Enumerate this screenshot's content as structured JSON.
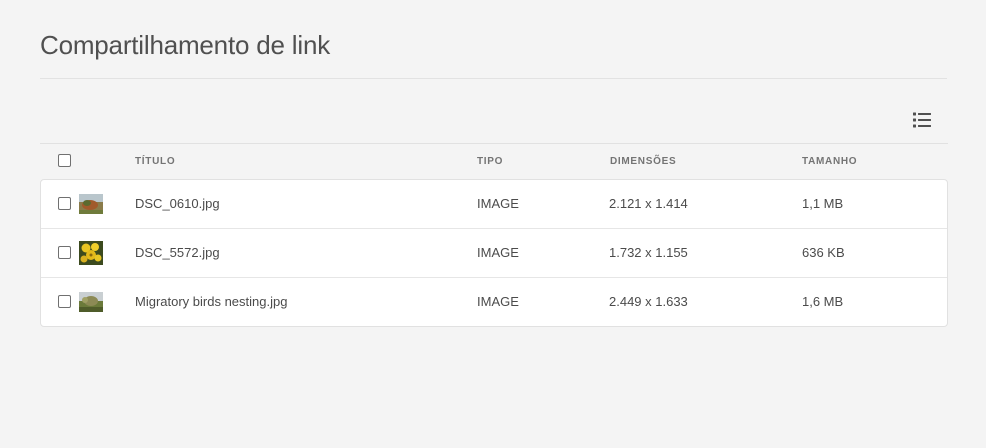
{
  "page": {
    "title": "Compartilhamento de link"
  },
  "toolbar": {
    "view_icon": "list-view-icon"
  },
  "table": {
    "columns": {
      "title": "TÍTULO",
      "type": "TIPO",
      "dimensions": "DIMENSÕES",
      "size": "TAMANHO"
    },
    "rows": [
      {
        "title": "DSC_0610.jpg",
        "type": "IMAGE",
        "dimensions": "2.121 x 1.414",
        "size": "1,1 MB",
        "thumb": "landscape-thumbnail"
      },
      {
        "title": "DSC_5572.jpg",
        "type": "IMAGE",
        "dimensions": "1.732 x 1.155",
        "size": "636 KB",
        "thumb": "yellow-flowers-thumbnail"
      },
      {
        "title": "Migratory birds nesting.jpg",
        "type": "IMAGE",
        "dimensions": "2.449 x 1.633",
        "size": "1,6 MB",
        "thumb": "birds-nesting-thumbnail"
      }
    ]
  },
  "colors": {
    "background": "#f4f4f4",
    "table_background": "#ffffff",
    "border": "#e1e1e1",
    "text": "#4b4b4b",
    "header_text": "#747474"
  }
}
